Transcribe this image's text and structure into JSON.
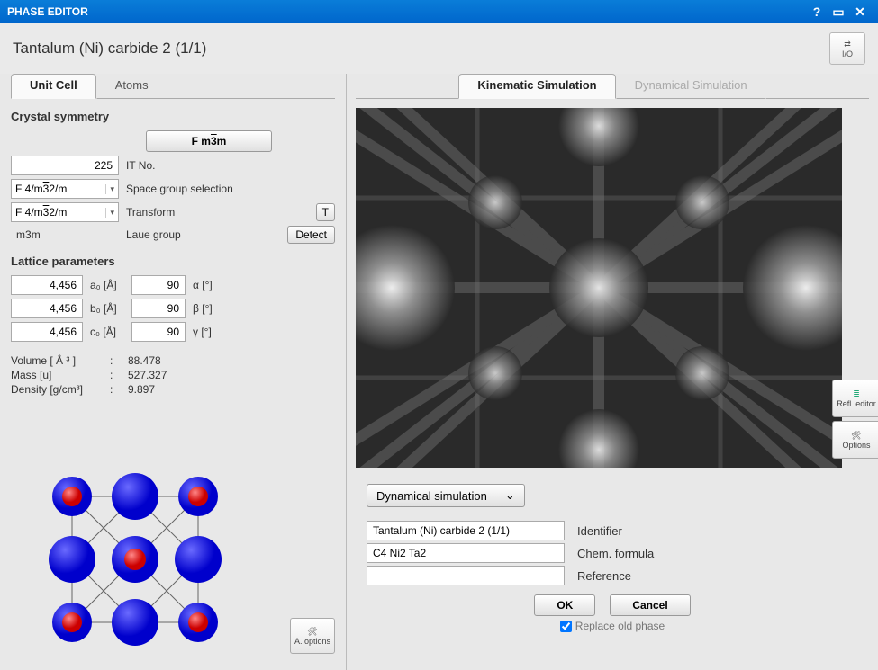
{
  "window": {
    "title": "PHASE EDITOR"
  },
  "header": {
    "title": "Tantalum (Ni) carbide 2 (1/1)",
    "io": "I/O"
  },
  "leftTabs": {
    "unitcell": "Unit Cell",
    "atoms": "Atoms"
  },
  "rightTabs": {
    "kinematic": "Kinematic Simulation",
    "dynamical": "Dynamical Simulation"
  },
  "symmetry": {
    "heading": "Crystal symmetry",
    "spacegroup_btn": "F m3m",
    "itno_value": "225",
    "itno_label": "IT No.",
    "sg1": "F 4/m3̅2/m",
    "sg_label": "Space group selection",
    "sg2": "F 4/m3̅2/m",
    "transform_label": "Transform",
    "t_btn": "T",
    "laue_value": "m3̅m",
    "laue_label": "Laue group",
    "detect_btn": "Detect"
  },
  "lattice": {
    "heading": "Lattice parameters",
    "a": {
      "val": "4,456",
      "lbl": "a₀ [Å]",
      "ang": "90",
      "anglbl": "α [°]"
    },
    "b": {
      "val": "4,456",
      "lbl": "b₀ [Å]",
      "ang": "90",
      "anglbl": "β [°]"
    },
    "c": {
      "val": "4,456",
      "lbl": "c₀ [Å]",
      "ang": "90",
      "anglbl": "γ [°]"
    }
  },
  "props": {
    "volume_k": "Volume [ Å ³ ]",
    "volume_v": "88.478",
    "mass_k": "Mass [u]",
    "mass_v": "527.327",
    "density_k": "Density [g/cm³]",
    "density_v": "9.897"
  },
  "aopt": "A. options",
  "sidebtns": {
    "refl": "Refl. editor",
    "options": "Options"
  },
  "sim_dropdown": "Dynamical simulation",
  "form": {
    "identifier_val": "Tantalum (Ni) carbide 2 (1/1)",
    "identifier_lbl": "Identifier",
    "formula_val": "C4 Ni2 Ta2",
    "formula_lbl": "Chem. formula",
    "reference_val": "",
    "reference_lbl": "Reference"
  },
  "buttons": {
    "ok": "OK",
    "cancel": "Cancel",
    "replace": "Replace old phase"
  }
}
